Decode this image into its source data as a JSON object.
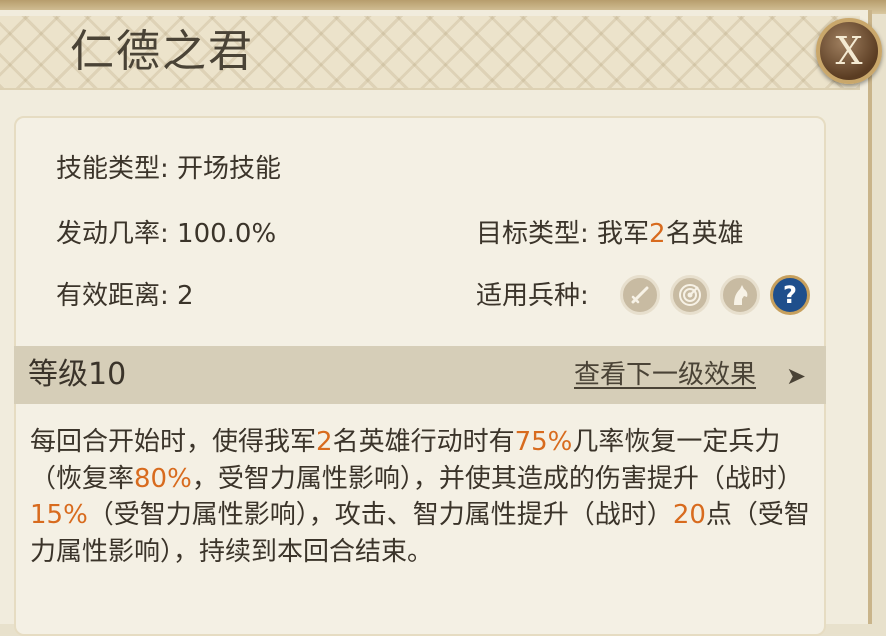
{
  "skill": {
    "title": "仁德之君",
    "close_label": "X"
  },
  "info": {
    "skill_type_label": "技能类型:",
    "skill_type_value": "开场技能",
    "trigger_rate_label": "发动几率:",
    "trigger_rate_value": "100.0%",
    "target_type_label": "目标类型:",
    "target_type_prefix": "我军",
    "target_type_count": "2",
    "target_type_suffix": "名英雄",
    "range_label": "有效距离:",
    "range_value": "2",
    "troop_label": "适用兵种:",
    "troop_icons": [
      "sword-icon",
      "archery-target-icon",
      "horse-icon",
      "help-icon"
    ],
    "help_glyph": "?"
  },
  "level": {
    "label": "等级10",
    "next_label": "查看下一级效果",
    "next_arrow": "➤"
  },
  "description": [
    {
      "text": "每回合开始时，使得我军",
      "hl": false
    },
    {
      "text": "2",
      "hl": true
    },
    {
      "text": "名英雄行动时有",
      "hl": false
    },
    {
      "text": "75%",
      "hl": true
    },
    {
      "text": "几率恢复一定兵力（恢复率",
      "hl": false
    },
    {
      "text": "80%",
      "hl": true
    },
    {
      "text": "，受智力属性影响），并使其造成的伤害提升（战时）",
      "hl": false
    },
    {
      "text": "15%",
      "hl": true
    },
    {
      "text": "（受智力属性影响），攻击、智力属性提升（战时）",
      "hl": false
    },
    {
      "text": "20",
      "hl": true
    },
    {
      "text": "点（受智力属性影响），持续到本回合结束。",
      "hl": false
    }
  ],
  "colors": {
    "highlight": "#d86b1e",
    "help_icon_bg": "#1f4f8c"
  }
}
